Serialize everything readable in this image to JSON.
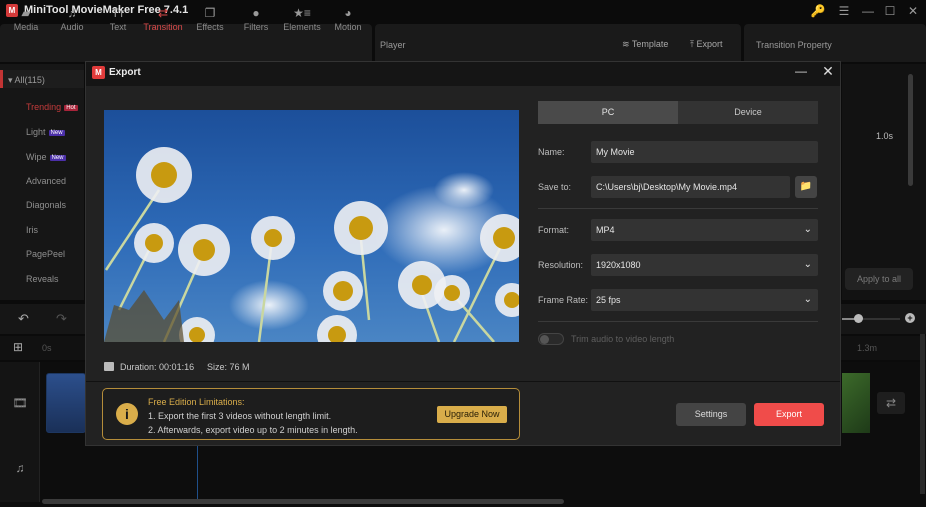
{
  "app": {
    "title": "MiniTool MovieMaker Free 7.4.1",
    "logo_glyph": "M",
    "window_controls": {
      "key": "🔑",
      "menu": "☰",
      "minimize": "—",
      "maximize": "☐",
      "close": "✕"
    }
  },
  "toolbar": {
    "items": [
      {
        "label": "Media",
        "icon": "▰",
        "active": false
      },
      {
        "label": "Audio",
        "icon": "♫",
        "active": false
      },
      {
        "label": "Text",
        "icon": "Tт",
        "active": false
      },
      {
        "label": "Transition",
        "icon": "⇄",
        "active": true
      },
      {
        "label": "Effects",
        "icon": "❐",
        "active": false
      },
      {
        "label": "Filters",
        "icon": "●",
        "active": false
      },
      {
        "label": "Elements",
        "icon": "★≡",
        "active": false
      },
      {
        "label": "Motion",
        "icon": "◕",
        "active": false
      }
    ],
    "active_color": "#d94a4a"
  },
  "player": {
    "label": "Player",
    "template_label": "Template",
    "template_icon": "≋",
    "export_label": "Export",
    "export_icon": "⤒"
  },
  "property_panel": {
    "title": "Transition Property",
    "duration_value": "1.0s",
    "apply_all_label": "Apply to all"
  },
  "transition_library": {
    "all_label": "All(115)",
    "categories": [
      {
        "label": "Trending",
        "badge": "Hot",
        "active": true
      },
      {
        "label": "Light",
        "badge": "New"
      },
      {
        "label": "Wipe",
        "badge": "New"
      },
      {
        "label": "Advanced"
      },
      {
        "label": "Diagonals"
      },
      {
        "label": "Iris"
      },
      {
        "label": "PagePeel"
      },
      {
        "label": "Reveals"
      }
    ]
  },
  "timeline": {
    "ruler_start": "0s",
    "ruler_end": "1.3m",
    "undo_icon": "↶",
    "redo_icon": "↷",
    "add_track_icon": "⊞",
    "video_track_icon": "🎞",
    "audio_track_icon": "♫",
    "transition_icon": "⇄",
    "zoom_plus": "+"
  },
  "export_dialog": {
    "title": "Export",
    "logo_glyph": "M",
    "minimize_glyph": "—",
    "close_glyph": "✕",
    "preview": {
      "duration_label": "Duration:",
      "duration_value": "00:01:16",
      "size_label": "Size:",
      "size_value": "76 M"
    },
    "tabs": [
      {
        "label": "PC",
        "active": true
      },
      {
        "label": "Device",
        "active": false
      }
    ],
    "fields": {
      "name": {
        "label": "Name:",
        "value": "My Movie"
      },
      "save_to": {
        "label": "Save to:",
        "value": "C:\\Users\\bj\\Desktop\\My Movie.mp4",
        "browse_icon": "📁"
      },
      "format": {
        "label": "Format:",
        "value": "MP4"
      },
      "resolution": {
        "label": "Resolution:",
        "value": "1920x1080"
      },
      "frame_rate": {
        "label": "Frame Rate:",
        "value": "25 fps"
      }
    },
    "chevron": "⌄",
    "trim_audio": {
      "label": "Trim audio to video length",
      "enabled": false
    },
    "notice": {
      "icon": "i",
      "title": "Free Edition Limitations:",
      "line1": "1. Export the first 3 videos without length limit.",
      "line2": "2. Afterwards, export video up to 2 minutes in length.",
      "upgrade_label": "Upgrade Now",
      "accent_color": "#d9ad4a"
    },
    "buttons": {
      "settings": "Settings",
      "export": "Export",
      "export_color": "#f04c4a"
    }
  }
}
